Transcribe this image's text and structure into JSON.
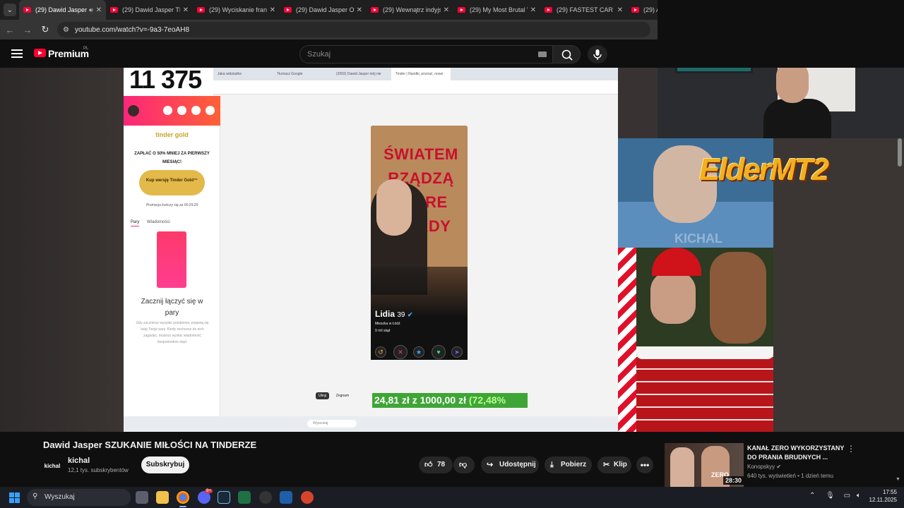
{
  "browser": {
    "tabs": [
      {
        "label": "(29) Dawid Jasper",
        "active": true
      },
      {
        "label": "(29) Dawid Jasper TE",
        "active": false
      },
      {
        "label": "(29) Wyciskanie franc",
        "active": false
      },
      {
        "label": "(29) Dawid Jasper ON",
        "active": false
      },
      {
        "label": "(29) Wewnątrz indyjsk",
        "active": false
      },
      {
        "label": "(29) My Most Brutal V",
        "active": false
      },
      {
        "label": "(29) FASTEST CAR ON",
        "active": false
      },
      {
        "label": "(29) A",
        "active": false
      }
    ],
    "url": "youtube.com/watch?v=-9a3-7eoAH8"
  },
  "yt_header": {
    "brand": "Premium",
    "country": "PL",
    "search_placeholder": "Szukaj"
  },
  "video": {
    "counter": "11 375",
    "inner_tabs": [
      "Jaka widziadno",
      "Tłumacz Google",
      "(2002) Dawid Jasper mój nie",
      "Tinder | Randki, poznać, nowe"
    ],
    "tinder": {
      "logo": "tinder gold",
      "promo": "ZAPŁAĆ O 50% MNIEJ ZA PIERWSZY MIESIĄC!",
      "gold_button": "Kup wersję Tinder Gold™",
      "promo_ends": "Promocja kończy się za 00:29:29",
      "tab_pairs": "Pary",
      "tab_messages": "Wiadomości",
      "start_title": "Zacznij łączyć się w pary",
      "start_desc": "Gdy zaczniesz wysyłać polubienia, pojawią się tutaj Twoje pary. Kiedy zechcesz do nich zagadać, możesz wysłać wiadomość bezpośrednio stąd."
    },
    "profile": {
      "graffiti": "ŚWIATEM RZĄDZĄ STARE PIERDY",
      "name": "Lidia",
      "age": "39",
      "location": "Mieszka w Łódź",
      "distance": "9 mil stąd"
    },
    "mini_buttons": [
      "Ukryj",
      "Zegnam"
    ],
    "donation": {
      "text": "24,81 zł z 1000,00 zł",
      "percent": "(72,48%"
    },
    "inner_search": "Wyszukaj",
    "overlay_logo": "ElderMT2",
    "watermark": "KICHAL"
  },
  "below_video": {
    "title": "Dawid Jasper SZUKANIE MIŁOŚCI NA TINDERZE",
    "channel": "kichal",
    "channel_avatar_text": "kichal",
    "subscribers": "12,1 tys. subskrybentów",
    "subscribe_label": "Subskrybuj",
    "likes": "78",
    "share_label": "Udostępnij",
    "download_label": "Pobierz",
    "clip_label": "Klip",
    "more_label": "•••"
  },
  "recommendation": {
    "title": "KANAŁ ZERO WYKORZYSTANY DO PRANIA BRUDNYCH ...",
    "channel": "Konopskyy",
    "meta": "640 tys. wyświetleń • 1 dzień temu",
    "duration": "28:30",
    "thumb_text": "ZERO"
  },
  "taskbar": {
    "search_placeholder": "Wyszukaj",
    "discord_badge": "9+",
    "time": "17:55",
    "date": "12.11.2025"
  }
}
